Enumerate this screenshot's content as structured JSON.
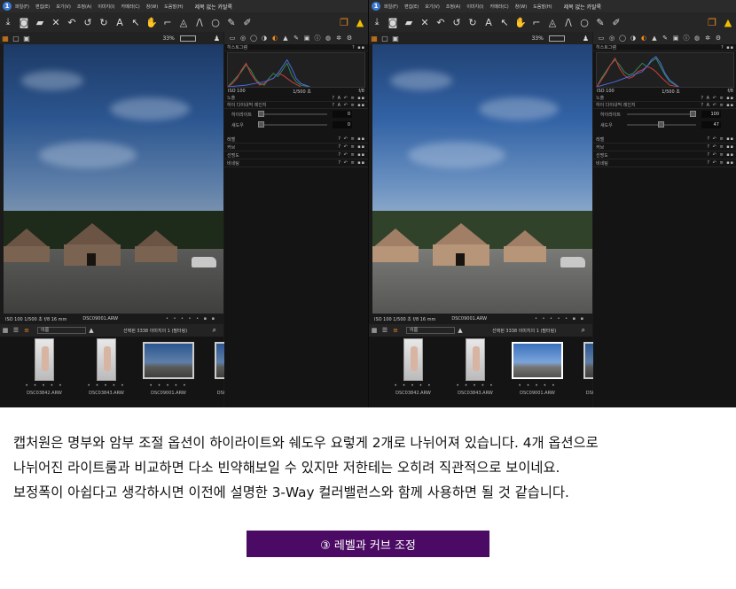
{
  "menu": {
    "app_icon": "1",
    "items": [
      "파일(F)",
      "편집(E)",
      "보기(V)",
      "조정(A)",
      "이미지(I)",
      "카메라(C)",
      "창(W)",
      "도움말(H)"
    ],
    "window_title": "제목 없는 카탈록"
  },
  "viewer": {
    "zoom": "33%",
    "status_exif": "ISO 100  1/500 초  f/8  16 mm",
    "status_filename": "DSC09001.ARW"
  },
  "browser": {
    "sort": "이름",
    "selection": "선택된 3338 이미지의 1 (필터링)"
  },
  "filmstrip": {
    "thumbnails": [
      {
        "name": "DSC03842.ARW"
      },
      {
        "name": "DSC03843.ARW"
      },
      {
        "name": "DSC09001.ARW"
      },
      {
        "name": "DSC"
      }
    ]
  },
  "panel": {
    "histogram_title": "히스토그램",
    "histo_iso": "ISO 100",
    "histo_shutter": "1/500 초",
    "histo_aperture": "f/8",
    "exposure_title": "노출",
    "hs_title": "하이 다이내믹 레인지",
    "highlight_label": "하이라이트",
    "shadow_label": "섀도우",
    "collapsed": [
      "레벨",
      "커브",
      "선명도",
      "비네팅"
    ]
  },
  "left_values": {
    "highlight": "0",
    "shadow": "0"
  },
  "right_values": {
    "highlight": "100",
    "shadow": "47"
  },
  "caption": {
    "line1": "캡처원은 명부와 암부 조절 옵션이 하이라이트와 쉐도우 요렇게 2개로 나뉘어져 있습니다. 4개 옵션으로",
    "line2": "나뉘어진 라이트룸과 비교하면 다소 빈약해보일 수 있지만 저한테는 오히려 직관적으로 보이네요.",
    "line3": "보정폭이 아쉽다고 생각하시면 이전에 설명한 3-Way 컬러밸런스와 함께 사용하면 될 것 같습니다."
  },
  "section_button": "③ 레벨과 커브 조정",
  "colors": {
    "accent": "#f08a1c",
    "section_bg": "#4b0a63"
  }
}
